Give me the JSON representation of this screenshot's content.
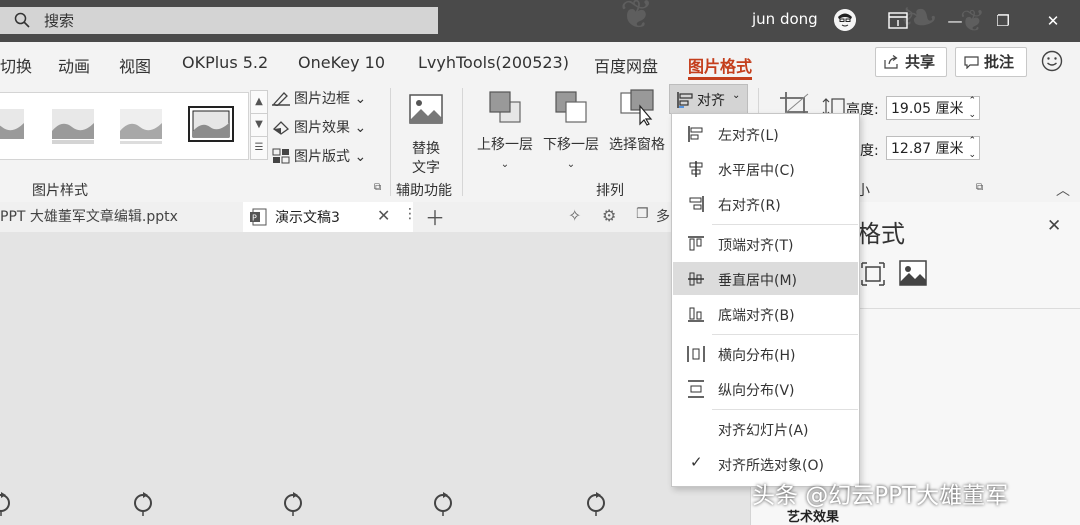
{
  "titlebar": {
    "search_placeholder": "搜索",
    "user": "jun dong",
    "minimize": "—",
    "restore": "❐",
    "close": "✕"
  },
  "tabs": [
    {
      "label": "切换"
    },
    {
      "label": "动画"
    },
    {
      "label": "视图"
    },
    {
      "label": "OKPlus 5.2"
    },
    {
      "label": "OneKey 10"
    },
    {
      "label": "LvyhTools(200523)"
    },
    {
      "label": "百度网盘"
    },
    {
      "label": "图片格式",
      "active": true
    }
  ],
  "toolbar": {
    "share": "共享",
    "comment": "批注"
  },
  "ribbon": {
    "picture_border": "图片边框",
    "picture_effects": "图片效果",
    "picture_layout": "图片版式",
    "group_picture_styles": "图片样式",
    "replace_text_line1": "替换",
    "replace_text_line2": "文字",
    "group_accessibility": "辅助功能",
    "bring_forward": "上移一层",
    "send_backward": "下移一层",
    "selection_pane": "选择窗格",
    "align": "对齐",
    "group_arrange": "排列",
    "height_label": "高度:",
    "height_value": "19.05 厘米",
    "width_label": "宽度:",
    "width_value": "12.87 厘米",
    "group_size": "大小"
  },
  "doc_tabs": {
    "file1": "PPT 大雄董军文章编辑.pptx",
    "file2": "演示文稿3",
    "more": "多"
  },
  "pane": {
    "title": "格式",
    "bottom_item": "艺术效果"
  },
  "align_menu": {
    "items": [
      {
        "label": "左对齐(L)"
      },
      {
        "label": "水平居中(C)"
      },
      {
        "label": "右对齐(R)"
      },
      {
        "label": "顶端对齐(T)"
      },
      {
        "label": "垂直居中(M)",
        "highlighted": true
      },
      {
        "label": "底端对齐(B)"
      },
      {
        "label": "横向分布(H)"
      },
      {
        "label": "纵向分布(V)"
      },
      {
        "label": "对齐幻灯片(A)"
      },
      {
        "label": "对齐所选对象(O)",
        "checked": true
      }
    ]
  },
  "watermark": "头条 @幻云PPT大雄董军",
  "colors": {
    "accent": "#c43e1c",
    "titlebar": "#4a4a4a",
    "ribbon": "#f3f3f3"
  }
}
